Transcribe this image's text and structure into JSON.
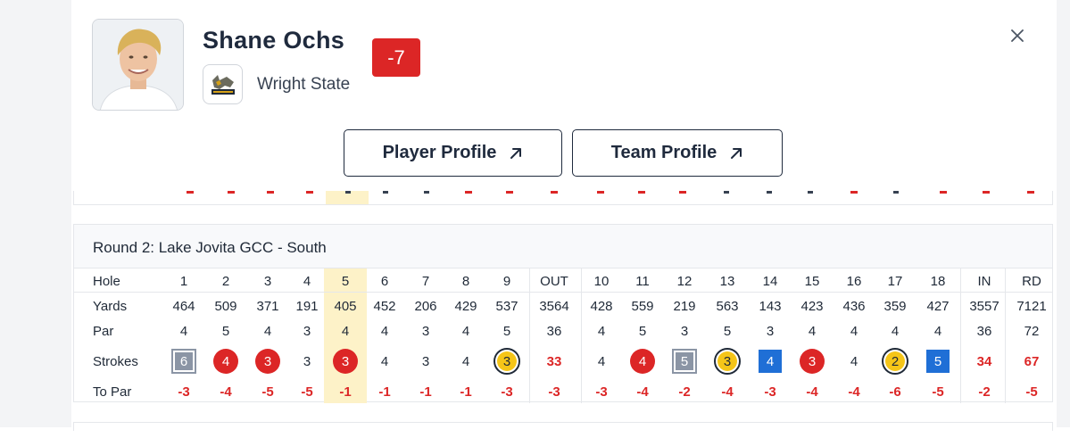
{
  "player": {
    "name": "Shane Ochs",
    "score": "-7",
    "team": "Wright State"
  },
  "buttons": {
    "player_profile": "Player Profile",
    "team_profile": "Team Profile"
  },
  "icons": {
    "close": "close-icon",
    "external": "arrow-up-right-icon"
  },
  "round": {
    "title": "Round 2: Lake Jovita GCC - South",
    "row_labels": {
      "hole": "Hole",
      "yards": "Yards",
      "par": "Par",
      "strokes": "Strokes",
      "to_par": "To Par"
    },
    "holes": [
      "1",
      "2",
      "3",
      "4",
      "5",
      "6",
      "7",
      "8",
      "9",
      "OUT",
      "10",
      "11",
      "12",
      "13",
      "14",
      "15",
      "16",
      "17",
      "18",
      "IN",
      "RD"
    ],
    "yards": [
      "464",
      "509",
      "371",
      "191",
      "405",
      "452",
      "206",
      "429",
      "537",
      "3564",
      "428",
      "559",
      "219",
      "563",
      "143",
      "423",
      "436",
      "359",
      "427",
      "3557",
      "7121"
    ],
    "par": [
      "4",
      "5",
      "4",
      "3",
      "4",
      "4",
      "3",
      "4",
      "5",
      "36",
      "4",
      "5",
      "3",
      "5",
      "3",
      "4",
      "4",
      "4",
      "4",
      "36",
      "72"
    ],
    "strokes": [
      "6",
      "4",
      "3",
      "3",
      "3",
      "4",
      "3",
      "4",
      "3",
      "33",
      "4",
      "4",
      "5",
      "3",
      "4",
      "3",
      "4",
      "2",
      "5",
      "34",
      "67"
    ],
    "stroke_marks": [
      "double-bogey",
      "birdie",
      "birdie",
      "par",
      "birdie",
      "par",
      "par",
      "par",
      "eagle",
      "total",
      "par",
      "birdie",
      "double-bogey",
      "eagle",
      "bogey",
      "birdie",
      "par",
      "eagle",
      "bogey",
      "total",
      "total"
    ],
    "to_par": [
      "-3",
      "-4",
      "-5",
      "-5",
      "-1",
      "-1",
      "-1",
      "-1",
      "-3",
      "-3",
      "-3",
      "-4",
      "-2",
      "-4",
      "-3",
      "-4",
      "-4",
      "-6",
      "-5",
      "-2",
      "-5"
    ]
  },
  "colors": {
    "birdie": "#dc2626",
    "eagle": "#f5c518",
    "bogey": "#1f6fd6",
    "double_bogey": "#8b95a5",
    "highlight": "#fdf2c8",
    "navy": "#1f2a3d"
  }
}
